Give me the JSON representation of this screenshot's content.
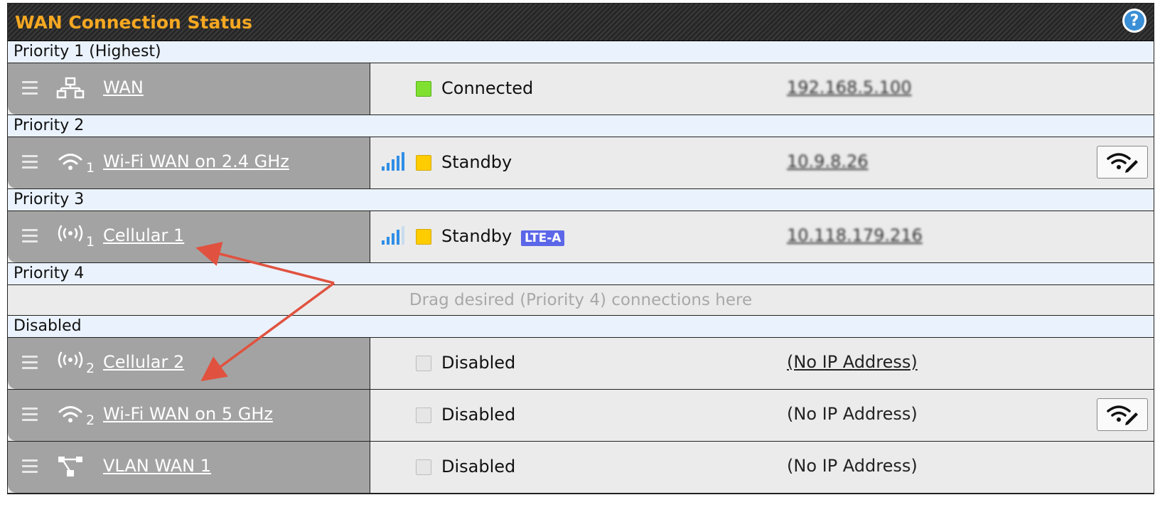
{
  "panel": {
    "title": "WAN Connection Status",
    "help_icon": "question-circle-icon"
  },
  "groups": {
    "p1": {
      "label": "Priority 1 (Highest)"
    },
    "p2": {
      "label": "Priority 2"
    },
    "p3": {
      "label": "Priority 3"
    },
    "p4": {
      "label": "Priority 4",
      "drop_hint": "Drag desired (Priority 4) connections here"
    },
    "disabled": {
      "label": "Disabled"
    }
  },
  "connections": {
    "wan": {
      "name": "WAN",
      "icon": "ethernet-network-icon",
      "index": "",
      "status": "Connected",
      "status_color": "#7fe030",
      "ip": "192.168.5.100"
    },
    "wifi24": {
      "name": "Wi-Fi WAN on 2.4 GHz",
      "icon": "wifi-icon",
      "index": "1",
      "status": "Standby",
      "status_color": "#ffcc00",
      "ip": "10.9.8.26",
      "signal_icon": "signal-bars-icon",
      "edit_icon": "wifi-edit-icon"
    },
    "cell1": {
      "name": "Cellular 1",
      "icon": "cellular-icon",
      "index": "1",
      "status": "Standby",
      "status_color": "#ffcc00",
      "badge": "LTE-A",
      "ip": "10.118.179.216",
      "signal_icon": "signal-bars-icon"
    },
    "cell2": {
      "name": "Cellular 2",
      "icon": "cellular-icon",
      "index": "2",
      "status": "Disabled",
      "status_color": "#e6e6e6",
      "ip": "(No IP Address)"
    },
    "wifi5": {
      "name": "Wi-Fi WAN on 5 GHz",
      "icon": "wifi-icon",
      "index": "2",
      "status": "Disabled",
      "status_color": "#e6e6e6",
      "ip": "(No IP Address)",
      "edit_icon": "wifi-edit-icon"
    },
    "vlan1": {
      "name": "VLAN WAN 1",
      "icon": "vlan-icon",
      "index": "",
      "status": "Disabled",
      "status_color": "#e6e6e6",
      "ip": "(No IP Address)"
    }
  },
  "colors": {
    "title_text": "#f6a821",
    "header_bg": "#eaf2fd",
    "row_left_bg": "#a3a3a3",
    "row_right_bg": "#ebebeb",
    "annotation_arrow": "#e0523f",
    "signal_bars": "#2f8ee6",
    "lte_badge": "#5b67e8"
  }
}
